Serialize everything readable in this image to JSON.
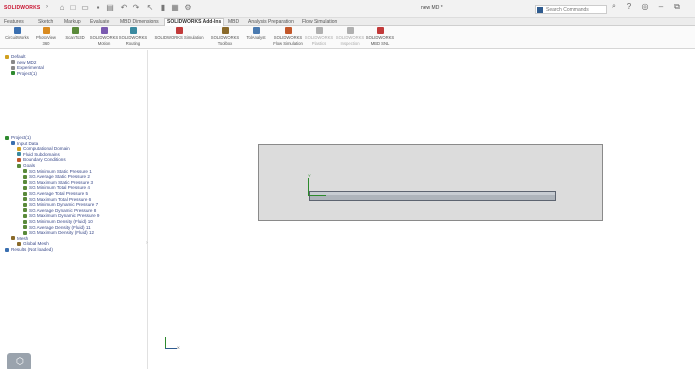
{
  "app": {
    "logo_text": "SOLIDWORKS",
    "document_title": "new MD *",
    "search_placeholder": "Search Commands"
  },
  "tabs": [
    {
      "label": "Features",
      "active": false
    },
    {
      "label": "Sketch",
      "active": false
    },
    {
      "label": "Markup",
      "active": false
    },
    {
      "label": "Evaluate",
      "active": false
    },
    {
      "label": "MBD Dimensions",
      "active": false
    },
    {
      "label": "SOLIDWORKS Add-Ins",
      "active": true
    },
    {
      "label": "MBD",
      "active": false
    },
    {
      "label": "Analysis Preparation",
      "active": false
    },
    {
      "label": "Flow Simulation",
      "active": false
    }
  ],
  "ribbon": [
    {
      "label1": "CircuitWorks",
      "label2": "",
      "color": "#3a6fb0",
      "disabled": false
    },
    {
      "label1": "PhotoView",
      "label2": "360",
      "color": "#d98a1e",
      "disabled": false
    },
    {
      "label1": "ScanTo3D",
      "label2": "",
      "color": "#5a8a3a",
      "disabled": false
    },
    {
      "label1": "SOLIDWORKS",
      "label2": "Motion",
      "color": "#7a5ab0",
      "disabled": false
    },
    {
      "label1": "SOLIDWORKS",
      "label2": "Routing",
      "color": "#3a8aa0",
      "disabled": false
    },
    {
      "label1": "SOLIDWORKS Simulation",
      "label2": "",
      "color": "#c23a3a",
      "disabled": false
    },
    {
      "label1": "SOLIDWORKS",
      "label2": "Toolbox",
      "color": "#8a6a2a",
      "disabled": false
    },
    {
      "label1": "TolAnalyst",
      "label2": "",
      "color": "#4a7ab0",
      "disabled": false
    },
    {
      "label1": "SOLIDWORKS",
      "label2": "Flow Simulation",
      "color": "#c2572a",
      "disabled": false
    },
    {
      "label1": "SOLIDWORKS",
      "label2": "Plastics",
      "color": "#b0b0b0",
      "disabled": true
    },
    {
      "label1": "SOLIDWORKS",
      "label2": "Inspection",
      "color": "#b0b0b0",
      "disabled": true
    },
    {
      "label1": "SOLIDWORKS",
      "label2": "MBD SNL",
      "color": "#c23a3a",
      "disabled": false
    }
  ],
  "tree": {
    "config": [
      {
        "label": "Default",
        "indent": 0,
        "icon_color": "#d0a020"
      },
      {
        "label": "new MD2",
        "indent": 1,
        "icon_color": "#8a8a8a"
      },
      {
        "label": "Experimental",
        "indent": 1,
        "icon_color": "#8a8a8a"
      },
      {
        "label": "Project(1)",
        "indent": 1,
        "icon_color": "#2f8a2f"
      }
    ],
    "project": [
      {
        "label": "Project(1)",
        "indent": 0,
        "icon_color": "#2f8a2f"
      },
      {
        "label": "Input Data",
        "indent": 1,
        "icon_color": "#3a6fb0"
      },
      {
        "label": "Computational Domain",
        "indent": 2,
        "icon_color": "#d0a020"
      },
      {
        "label": "Fluid Subdomains",
        "indent": 2,
        "icon_color": "#3a8aa0"
      },
      {
        "label": "Boundary Conditions",
        "indent": 2,
        "icon_color": "#c2572a"
      },
      {
        "label": "Goals",
        "indent": 2,
        "icon_color": "#5a8a3a"
      },
      {
        "label": "SG Minimum Static Pressure 1",
        "indent": 3,
        "icon_color": "#5a8a3a"
      },
      {
        "label": "SG Average Static Pressure 2",
        "indent": 3,
        "icon_color": "#5a8a3a"
      },
      {
        "label": "SG Maximum Static Pressure 3",
        "indent": 3,
        "icon_color": "#5a8a3a"
      },
      {
        "label": "SG Minimum Total Pressure 4",
        "indent": 3,
        "icon_color": "#5a8a3a"
      },
      {
        "label": "SG Average Total Pressure 5",
        "indent": 3,
        "icon_color": "#5a8a3a"
      },
      {
        "label": "SG Maximum Total Pressure 6",
        "indent": 3,
        "icon_color": "#5a8a3a"
      },
      {
        "label": "SG Minimum Dynamic Pressure 7",
        "indent": 3,
        "icon_color": "#5a8a3a"
      },
      {
        "label": "SG Average Dynamic Pressure 8",
        "indent": 3,
        "icon_color": "#5a8a3a"
      },
      {
        "label": "SG Maximum Dynamic Pressure 9",
        "indent": 3,
        "icon_color": "#5a8a3a"
      },
      {
        "label": "SG Minimum Density (Fluid) 10",
        "indent": 3,
        "icon_color": "#5a8a3a"
      },
      {
        "label": "SG Average Density (Fluid) 11",
        "indent": 3,
        "icon_color": "#5a8a3a"
      },
      {
        "label": "SG Maximum Density (Fluid) 12",
        "indent": 3,
        "icon_color": "#5a8a3a"
      },
      {
        "label": "Mesh",
        "indent": 1,
        "icon_color": "#8a6a2a"
      },
      {
        "label": "Global Mesh",
        "indent": 2,
        "icon_color": "#8a6a2a"
      },
      {
        "label": "Results (Not loaded)",
        "indent": 0,
        "icon_color": "#3a6fb0"
      }
    ]
  },
  "viewport": {
    "triad_label": "Y",
    "ref_triad_label": "X"
  }
}
